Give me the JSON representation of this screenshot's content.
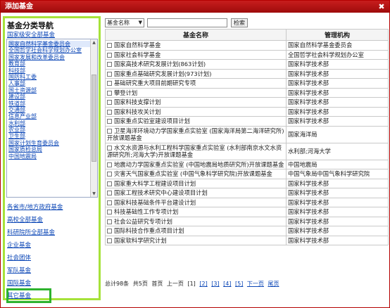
{
  "window": {
    "title": "添加基金",
    "close_glyph": "✖"
  },
  "leftnav": {
    "title": "基金分类导航",
    "top_link": "国家级安全部基金",
    "list_items": [
      "国家自然科学基金委员会",
      "全国哲学社会科学规划办公室",
      "国家发展和改革委员会",
      "教育部",
      "科技部",
      "国防科工委",
      "人事部",
      "国土资源部",
      "建设部",
      "铁道部",
      "交通部",
      "信息产业部",
      "水利部",
      "农业部",
      "卫生部",
      "国家计划生育委员会",
      "国家质检总局",
      "中国地震局"
    ],
    "groups": [
      "各省市/地方政府基金",
      "高校全部基金",
      "科研院所全部基金",
      "企业基金",
      "社会团体",
      "军队基金",
      "国际基金",
      "其它基金"
    ]
  },
  "search": {
    "select_value": "基金名称",
    "button": "检索",
    "input_value": ""
  },
  "table": {
    "headers": [
      "基金名称",
      "管理机构"
    ],
    "rows": [
      {
        "name": "国家自然科学基金",
        "org": "国家自然科学基金委员会"
      },
      {
        "name": "国家社会科学基金",
        "org": "全国哲学社会科学规划办公室"
      },
      {
        "name": "国家高技术研究发展计划(863计划)",
        "org": "国家科学技术部"
      },
      {
        "name": "国家重点基础研究发展计划(973计划)",
        "org": "国家科学技术部"
      },
      {
        "name": "基础研究重大项目前期研究专项",
        "org": "国家科学技术部"
      },
      {
        "name": "攀登计划",
        "org": "国家科学技术部"
      },
      {
        "name": "国家科技支撑计划",
        "org": "国家科学技术部"
      },
      {
        "name": "国家科技攻关计划",
        "org": "国家科学技术部"
      },
      {
        "name": "国家重点实验室建设项目计划",
        "org": "国家科学技术部"
      },
      {
        "name": "卫星海洋环境动力学国家重点实验室 (国家海洋局第二海洋研究所)开放课题基金",
        "org": "国家海洋局"
      },
      {
        "name": "水文水资源与水利工程科学国家重点实验室 (水利部南京水文水资源研究所;河海大学)开放课题基金",
        "org": "水利部;河海大学"
      },
      {
        "name": "地震动力学国家重点实验室 (中国地震局地质研究所)开放课题基金",
        "org": "中国地震局"
      },
      {
        "name": "灾害天气国家重点实验室 (中国气象科学研究院)开放课题基金",
        "org": "中国气象局中国气象科学研究院"
      },
      {
        "name": "国家重大科学工程建设项目计划",
        "org": "国家科学技术部"
      },
      {
        "name": "国家工程技术研究中心建设项目计划",
        "org": "国家科学技术部"
      },
      {
        "name": "国家科技基础条件平台建设计划",
        "org": "国家科学技术部"
      },
      {
        "name": "科技基础性工作专项计划",
        "org": "国家科学技术部"
      },
      {
        "name": "社会公益研究专项计划",
        "org": "国家科学技术部"
      },
      {
        "name": "国际科技合作重点项目计划",
        "org": "国家科学技术部"
      },
      {
        "name": "国家软科学研究计划",
        "org": "国家科学技术部"
      }
    ]
  },
  "pager": {
    "total": "总计98条",
    "pages": "共5页",
    "first": "首页",
    "prev": "上一页",
    "page_links": [
      "[1]",
      "[2]",
      "[3]",
      "[4]",
      "[5]"
    ],
    "next": "下一页",
    "last": "尾页"
  }
}
